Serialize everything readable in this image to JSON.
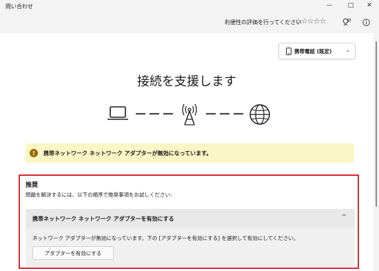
{
  "window": {
    "title": "問い合わせ",
    "minimize_glyph": "—",
    "maximize_glyph": "□",
    "close_glyph": "✕"
  },
  "rating": {
    "prompt": "利便性の評価を行ってください",
    "stars": "☆☆☆☆☆",
    "star_count": 5,
    "selected": 0
  },
  "toolbar": {
    "feedback_icon": "feedback-icon",
    "info_icon": "info-icon"
  },
  "device_selector": {
    "selected": "携帯電話 (既定)",
    "icon": "phone-icon",
    "chevron": "⌄"
  },
  "page": {
    "heading": "接続を支援します"
  },
  "connection_diagram": {
    "icons": [
      "laptop-icon",
      "antenna-icon",
      "globe-icon"
    ],
    "link_status": "disconnected"
  },
  "alert": {
    "icon": "!",
    "message": "携帯ネットワーク ネットワーク アダプターが無効になっています。",
    "color": "#fbf6c6"
  },
  "recommendation": {
    "title": "推奨",
    "description": "問題を解決するには、以下の順序で推奨事項をお試しください:",
    "highlight_color": "#d9262e",
    "item": {
      "title": "携帯ネットワーク ネットワーク アダプターを有効にする",
      "chevron": "^",
      "expanded": true,
      "body": "ネットワーク アダプターが無効になっています。下の [アダプターを有効にする] を選択して有効にしてください。",
      "button_label": "アダプターを有効にする"
    }
  }
}
